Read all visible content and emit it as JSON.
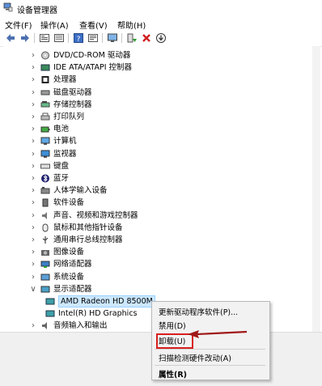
{
  "window": {
    "title": "设备管理器",
    "icon": "device-manager-icon"
  },
  "menu": {
    "file": "文件(F)",
    "action": "操作(A)",
    "view": "查看(V)",
    "help": "帮助(H)"
  },
  "toolbar": {
    "icons": [
      "back-arrow-icon",
      "forward-arrow-icon",
      "properties-icon",
      "refresh-icon",
      "help-icon",
      "details-icon",
      "monitor-icon",
      "update-driver-icon",
      "uninstall-x-icon",
      "download-icon"
    ]
  },
  "tree": {
    "nodes": [
      {
        "label": "DVD/CD-ROM 驱动器",
        "icon": "dvd-icon"
      },
      {
        "label": "IDE ATA/ATAPI 控制器",
        "icon": "ide-controller-icon"
      },
      {
        "label": "处理器",
        "icon": "processor-icon"
      },
      {
        "label": "磁盘驱动器",
        "icon": "disk-drive-icon"
      },
      {
        "label": "存储控制器",
        "icon": "storage-controller-icon"
      },
      {
        "label": "打印队列",
        "icon": "printer-icon"
      },
      {
        "label": "电池",
        "icon": "battery-icon"
      },
      {
        "label": "计算机",
        "icon": "computer-icon"
      },
      {
        "label": "监视器",
        "icon": "monitor-icon"
      },
      {
        "label": "键盘",
        "icon": "keyboard-icon"
      },
      {
        "label": "蓝牙",
        "icon": "bluetooth-icon"
      },
      {
        "label": "人体学输入设备",
        "icon": "hid-icon"
      },
      {
        "label": "软件设备",
        "icon": "software-device-icon"
      },
      {
        "label": "声音、视频和游戏控制器",
        "icon": "sound-icon"
      },
      {
        "label": "鼠标和其他指针设备",
        "icon": "mouse-icon"
      },
      {
        "label": "通用串行总线控制器",
        "icon": "usb-icon"
      },
      {
        "label": "图像设备",
        "icon": "camera-icon"
      },
      {
        "label": "网络适配器",
        "icon": "network-adapter-icon"
      },
      {
        "label": "系统设备",
        "icon": "system-device-icon"
      },
      {
        "label": "显示适配器",
        "icon": "display-adapter-icon"
      }
    ],
    "children": [
      {
        "label": "AMD Radeon HD 8500M",
        "icon": "display-card-icon"
      },
      {
        "label": "Intel(R) HD Graphics",
        "icon": "display-card-icon"
      }
    ],
    "after": {
      "label": "音频输入和输出",
      "icon": "audio-io-icon"
    }
  },
  "context_menu": {
    "update_driver": "更新驱动程序软件(P)...",
    "disable": "禁用(D)",
    "uninstall": "卸载(U)",
    "scan": "扫描检测硬件改动(A)",
    "properties": "属性(R)"
  },
  "colors": {
    "highlight_box": "#d81e1e",
    "annotation_arrow": "#a01818",
    "selection": "#cce8ff"
  }
}
